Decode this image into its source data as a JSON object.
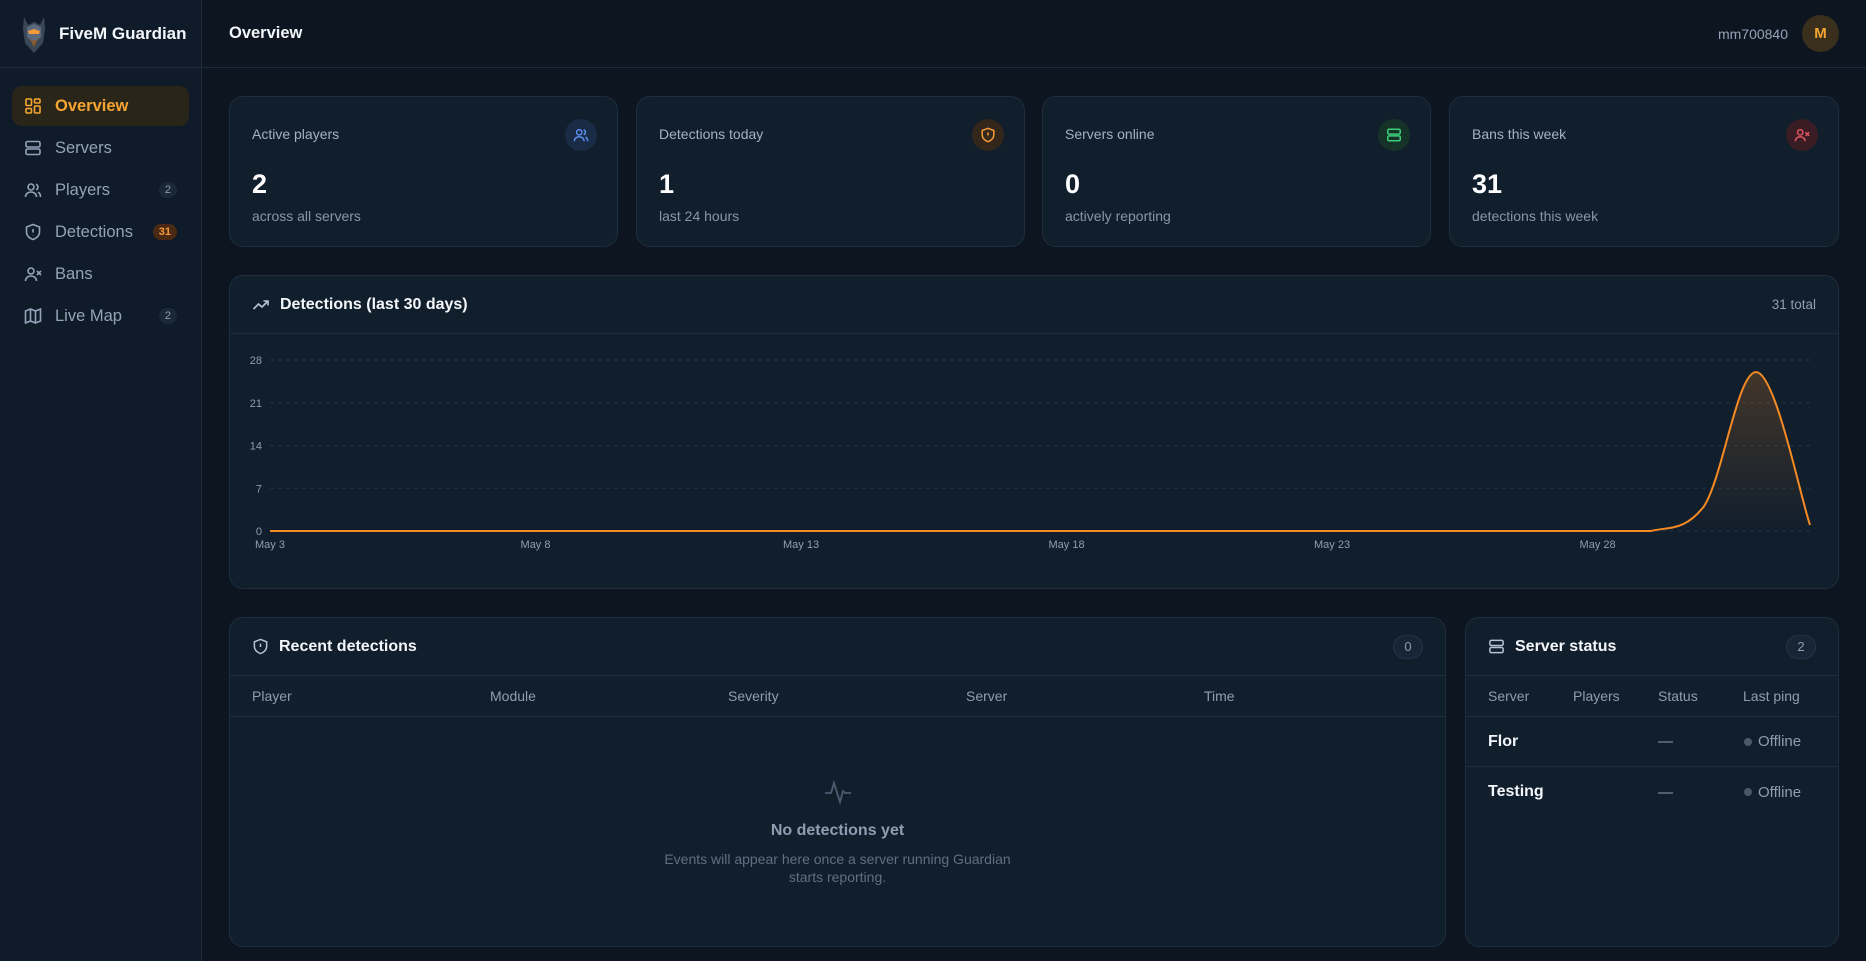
{
  "brand": {
    "name": "FiveM Guardian"
  },
  "nav": [
    {
      "label": "Overview",
      "icon": "grid-icon",
      "badge": "",
      "active": true
    },
    {
      "label": "Servers",
      "icon": "server-icon",
      "badge": ""
    },
    {
      "label": "Players",
      "icon": "users-icon",
      "badge": "2"
    },
    {
      "label": "Detections",
      "icon": "shield-icon",
      "badge": "31"
    },
    {
      "label": "Bans",
      "icon": "user-x-icon",
      "badge": ""
    },
    {
      "label": "Live Map",
      "icon": "map-icon",
      "badge": "2"
    }
  ],
  "header": {
    "title": "Overview",
    "username": "mm700840",
    "avatar_initial": "M"
  },
  "stats": [
    {
      "label": "Active players",
      "value": "2",
      "sub": "across all servers",
      "icon": "users-icon",
      "color": "#5b8def"
    },
    {
      "label": "Detections today",
      "value": "1",
      "sub": "last 24 hours",
      "icon": "shield-icon",
      "color": "#f59a3a"
    },
    {
      "label": "Servers online",
      "value": "0",
      "sub": "actively reporting",
      "icon": "server-icon",
      "color": "#3ccf7a"
    },
    {
      "label": "Bans this week",
      "value": "31",
      "sub": "detections this week",
      "icon": "user-x-icon",
      "color": "#e0555f"
    }
  ],
  "detections_chart": {
    "title": "Detections (last 30 days)",
    "total_label": "31 total"
  },
  "chart_data": {
    "type": "area",
    "title": "Detections (last 30 days)",
    "xlabel": "",
    "ylabel": "",
    "x": [
      "May 3",
      "May 4",
      "May 5",
      "May 6",
      "May 7",
      "May 8",
      "May 9",
      "May 10",
      "May 11",
      "May 12",
      "May 13",
      "May 14",
      "May 15",
      "May 16",
      "May 17",
      "May 18",
      "May 19",
      "May 20",
      "May 21",
      "May 22",
      "May 23",
      "May 24",
      "May 25",
      "May 26",
      "May 27",
      "May 28",
      "May 29",
      "May 30",
      "May 31",
      "Jun 1"
    ],
    "series": [
      {
        "values": [
          0,
          0,
          0,
          0,
          0,
          0,
          0,
          0,
          0,
          0,
          0,
          0,
          0,
          0,
          0,
          0,
          0,
          0,
          0,
          0,
          0,
          0,
          0,
          0,
          0,
          0,
          0,
          4,
          26,
          1
        ]
      }
    ],
    "x_tick_labels": [
      "May 3",
      "May 8",
      "May 13",
      "May 18",
      "May 23",
      "May 28"
    ],
    "y_ticks": [
      0,
      7,
      14,
      21,
      28
    ],
    "ylim": [
      0,
      28
    ],
    "grid": true,
    "line_color": "#f58a25"
  },
  "recent": {
    "title": "Recent detections",
    "count": "0",
    "columns": [
      "Player",
      "Module",
      "Severity",
      "Server",
      "Time"
    ],
    "empty_title": "No detections yet",
    "empty_sub_line1": "Events will appear here once a server running Guardian",
    "empty_sub_line2": "starts reporting."
  },
  "server_status": {
    "title": "Server status",
    "count": "2",
    "columns": [
      "Server",
      "Players",
      "Status",
      "Last ping"
    ],
    "rows": [
      {
        "name": "Flor",
        "players": "",
        "status": "—",
        "ping": "Offline"
      },
      {
        "name": "Testing",
        "players": "",
        "status": "—",
        "ping": "Offline"
      }
    ]
  }
}
